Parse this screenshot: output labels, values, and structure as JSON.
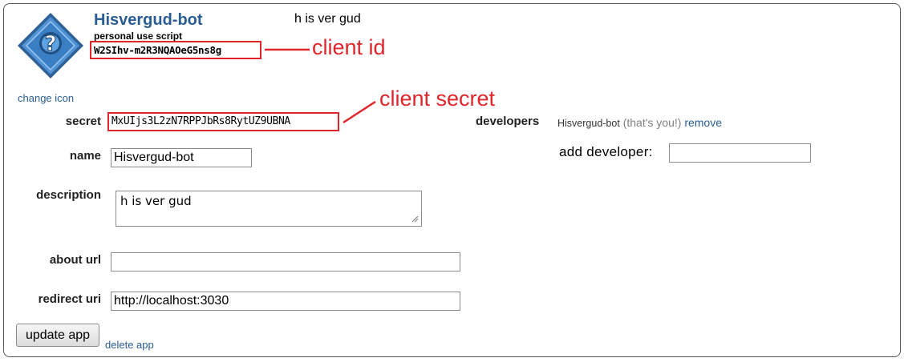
{
  "app": {
    "name": "Hisvergud-bot",
    "type": "personal use script",
    "client_id": "W2SIhv-m2R3NQAOeG5ns8g",
    "description_header": "h is ver gud",
    "change_icon": "change icon",
    "icon_name": "question-mark-diamond-icon"
  },
  "annotations": {
    "client_id": "client id",
    "client_secret": "client secret",
    "color": "#e0262c"
  },
  "form": {
    "secret_label": "secret",
    "secret_value": "MxUIjs3L2zN7RPPJbRs8RytUZ9UBNA",
    "name_label": "name",
    "name_value": "Hisvergud-bot",
    "description_label": "description",
    "description_value": "h is ver gud",
    "about_url_label": "about url",
    "about_url_value": "",
    "redirect_uri_label": "redirect uri",
    "redirect_uri_value": "http://localhost:3030",
    "update_button": "update app",
    "delete_link": "delete app"
  },
  "developers": {
    "label": "developers",
    "user": "Hisvergud-bot",
    "you_note": "(that's you!)",
    "remove": "remove",
    "add_label": "add developer:",
    "add_value": ""
  },
  "colors": {
    "link": "#2a5d93",
    "highlight": "#e0262c",
    "icon_blue": "#3f86c9"
  }
}
